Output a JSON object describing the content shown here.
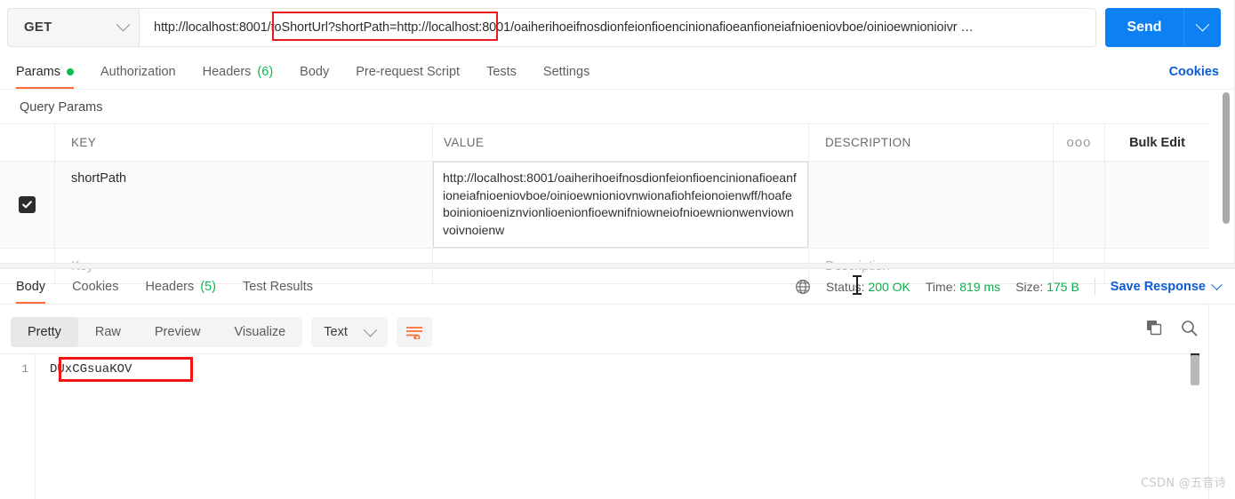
{
  "request": {
    "method": "GET",
    "url": "http://localhost:8001/toShortUrl?shortPath=http://localhost:8001/oaiherihoeifnosdionfeionfioencinionafioeanfioneiafnioeniovboe/oinioewnionioivr …",
    "send_label": "Send"
  },
  "request_tabs": [
    {
      "label": "Params",
      "badge": "dot"
    },
    {
      "label": "Authorization",
      "badge": ""
    },
    {
      "label": "Headers",
      "badge": "(6)"
    },
    {
      "label": "Body",
      "badge": ""
    },
    {
      "label": "Pre-request Script",
      "badge": ""
    },
    {
      "label": "Tests",
      "badge": ""
    },
    {
      "label": "Settings",
      "badge": ""
    }
  ],
  "cookies_link": "Cookies",
  "query_params": {
    "section_title": "Query Params",
    "columns": {
      "key": "KEY",
      "value": "VALUE",
      "description": "DESCRIPTION"
    },
    "bulk_edit": "Bulk Edit",
    "dots": "ooo",
    "rows": [
      {
        "checked": true,
        "key": "shortPath",
        "value": "http://localhost:8001/oaiherihoeifnosdionfeionfioencinionafioeanfioneiafnioeniovboe/oinioewnioniovnwionafiohfeionoienwff/hoafeboinionioeniznvionlioenionfioewnifniowneiofnioewnionwenviownvoivnoienw",
        "description": ""
      },
      {
        "checked": false,
        "key_placeholder": "Key",
        "value_placeholder": "",
        "description_placeholder": "Description"
      }
    ]
  },
  "response_tabs": [
    {
      "label": "Body",
      "badge": ""
    },
    {
      "label": "Cookies",
      "badge": ""
    },
    {
      "label": "Headers",
      "badge": "(5)"
    },
    {
      "label": "Test Results",
      "badge": ""
    }
  ],
  "response_status": {
    "status_label": "Status:",
    "status_value": "200 OK",
    "time_label": "Time:",
    "time_value": "819 ms",
    "size_label": "Size:",
    "size_value": "175 B",
    "save_response": "Save Response"
  },
  "body_toolbar": {
    "views": [
      "Pretty",
      "Raw",
      "Preview",
      "Visualize"
    ],
    "active_view": "Pretty",
    "format": "Text"
  },
  "response_body": {
    "line_number": "1",
    "content": "DUxCGsuaKOV"
  },
  "watermark": "CSDN @五音诗",
  "colors": {
    "accent_orange": "#ff6c37",
    "link_blue": "#0d5cd6",
    "send_blue": "#0d80f2",
    "status_green": "#0cae4e",
    "annotation_red": "#f01414"
  }
}
